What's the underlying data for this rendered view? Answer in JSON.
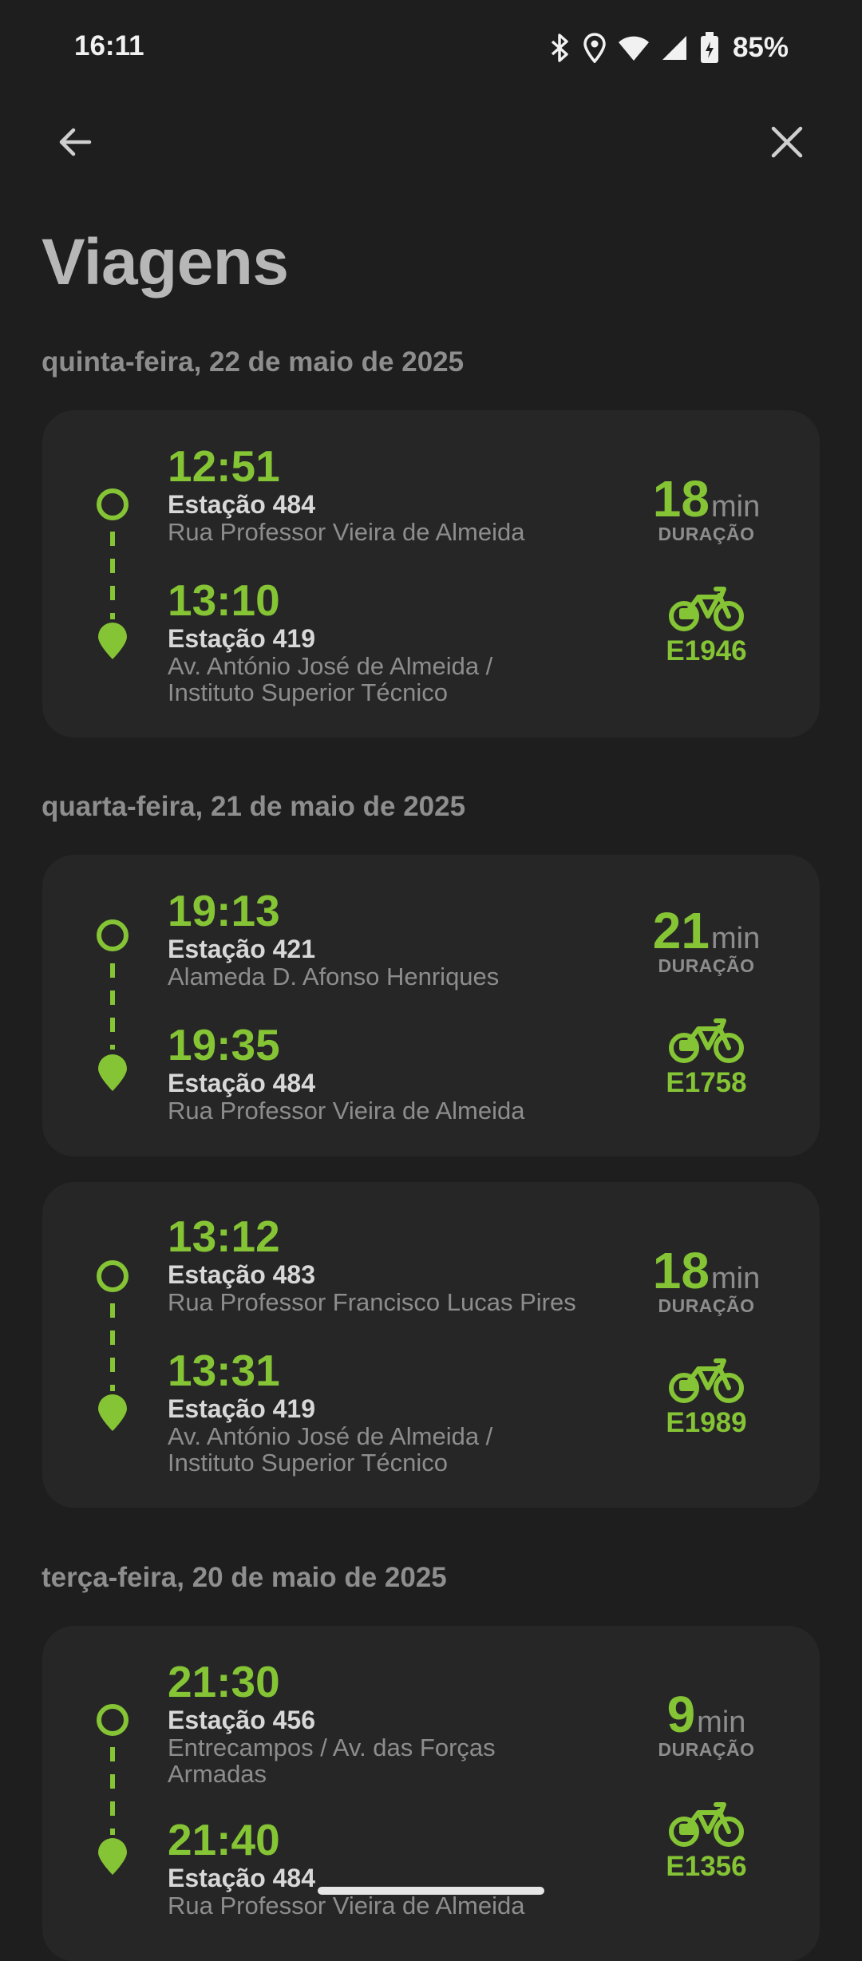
{
  "status_bar": {
    "time": "16:11",
    "battery": "85%"
  },
  "header": {
    "title": "Viagens"
  },
  "groups": [
    {
      "date": "quinta-feira, 22 de maio de 2025"
    },
    {
      "date": "quarta-feira, 21 de maio de 2025"
    },
    {
      "date": "terça-feira, 20 de maio de 2025"
    }
  ],
  "trips": [
    {
      "start": {
        "time": "12:51",
        "station": "Estação 484",
        "address": "Rua Professor Vieira de Almeida"
      },
      "end": {
        "time": "13:10",
        "station": "Estação 419",
        "address": "Av. António José de Almeida / Instituto Superior Técnico"
      },
      "duration": "18",
      "unit": "min",
      "duration_label": "DURAÇÃO",
      "bike": "E1946"
    },
    {
      "start": {
        "time": "19:13",
        "station": "Estação 421",
        "address": "Alameda D. Afonso Henriques"
      },
      "end": {
        "time": "19:35",
        "station": "Estação 484",
        "address": "Rua Professor Vieira de Almeida"
      },
      "duration": "21",
      "unit": "min",
      "duration_label": "DURAÇÃO",
      "bike": "E1758"
    },
    {
      "start": {
        "time": "13:12",
        "station": "Estação 483",
        "address": "Rua Professor Francisco Lucas Pires"
      },
      "end": {
        "time": "13:31",
        "station": "Estação 419",
        "address": "Av. António José de Almeida / Instituto Superior Técnico"
      },
      "duration": "18",
      "unit": "min",
      "duration_label": "DURAÇÃO",
      "bike": "E1989"
    },
    {
      "start": {
        "time": "21:30",
        "station": "Estação 456",
        "address": "Entrecampos / Av. das Forças Armadas"
      },
      "end": {
        "time": "21:40",
        "station": "Estação 484",
        "address": "Rua Professor Vieira de Almeida"
      },
      "duration": "9",
      "unit": "min",
      "duration_label": "DURAÇÃO",
      "bike": "E1356"
    }
  ],
  "icons": {
    "back": "arrow-left-icon",
    "close": "close-icon",
    "bike": "bicycle-icon",
    "start": "ring-icon",
    "end": "location-pin-icon"
  },
  "colors": {
    "accent": "#85c434",
    "background": "#1e1e1f",
    "card": "#262627"
  }
}
